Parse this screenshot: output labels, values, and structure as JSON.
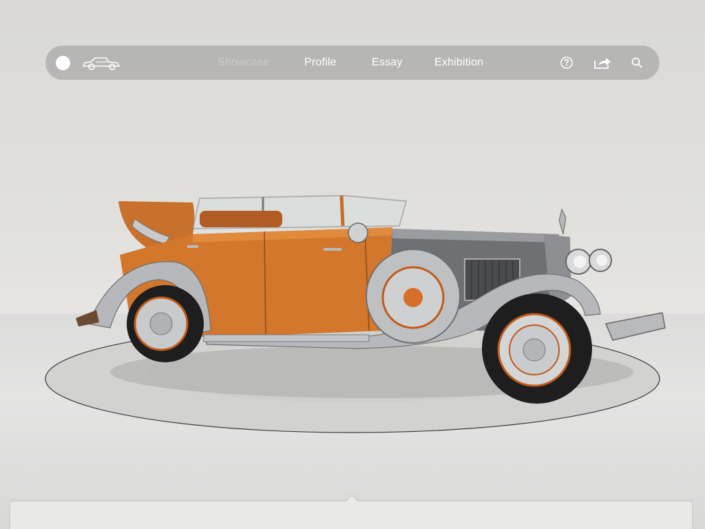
{
  "nav": {
    "tabs": [
      {
        "label": "Showcase",
        "active": false
      },
      {
        "label": "Profile",
        "active": true
      },
      {
        "label": "Essay",
        "active": true
      },
      {
        "label": "Exhibition",
        "active": true
      }
    ],
    "icons": {
      "home": "circle-icon",
      "logo": "vintage-car-icon",
      "help": "question-icon",
      "share": "share-icon",
      "search": "search-icon"
    }
  },
  "scene": {
    "subject": "vintage-convertible-car-image",
    "body_color": "#d2772c",
    "chrome_color": "#b8b9bb"
  },
  "colors": {
    "navbar_bg": "#a0a09e",
    "nav_text": "#ffffff",
    "background": "#e0dfdc",
    "panel_bg": "#e9e9e6"
  }
}
